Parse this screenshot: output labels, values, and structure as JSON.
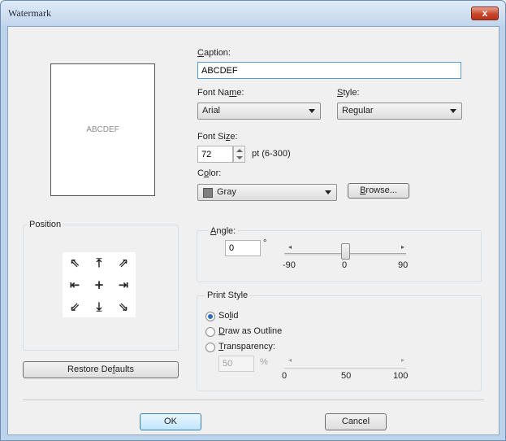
{
  "window": {
    "title": "Watermark",
    "close_glyph": "x"
  },
  "preview": {
    "text": "ABCDEF"
  },
  "caption": {
    "label": "Caption:",
    "label_mnemonic": "C",
    "label_rest": "aption:",
    "value": "ABCDEF"
  },
  "font_name": {
    "label_pre": "Font Na",
    "label_mnemonic": "m",
    "label_post": "e:",
    "value": "Arial"
  },
  "style": {
    "label_mnemonic": "S",
    "label_rest": "tyle:",
    "value": "Regular"
  },
  "font_size": {
    "label_pre": "Font Si",
    "label_mnemonic": "z",
    "label_post": "e:",
    "value": "72",
    "range_text": "pt (6-300)"
  },
  "color": {
    "label_pre": "C",
    "label_mnemonic": "o",
    "label_post": "lor:",
    "value": "Gray",
    "swatch": "#808080"
  },
  "browse": {
    "label_mnemonic": "B",
    "label_rest": "rowse..."
  },
  "position": {
    "title": "Position",
    "arrows": [
      "⇖",
      "⤒",
      "⇗",
      "⇤",
      "+",
      "⇥",
      "⇙",
      "⤓",
      "⇘"
    ],
    "arrow_icons": [
      "arrow-top-left-icon",
      "arrow-top-icon",
      "arrow-top-right-icon",
      "arrow-left-icon",
      "center-icon",
      "arrow-right-icon",
      "arrow-bottom-left-icon",
      "arrow-bottom-icon",
      "arrow-bottom-right-icon"
    ]
  },
  "restore": {
    "label_pre": "Restore De",
    "label_mnemonic": "f",
    "label_post": "aults"
  },
  "angle": {
    "label_mnemonic": "A",
    "label_rest": "ngle:",
    "value": "0",
    "unit": "°",
    "min_label": "-90",
    "mid_label": "0",
    "max_label": "90",
    "slider_value": 0
  },
  "print_style": {
    "title": "Print Style",
    "options": [
      {
        "pre": "So",
        "mnemonic": "l",
        "post": "id",
        "selected": true
      },
      {
        "pre": "",
        "mnemonic": "D",
        "post": "raw as Outline",
        "selected": false
      },
      {
        "pre": "",
        "mnemonic": "T",
        "post": "ransparency:",
        "selected": false
      }
    ],
    "transparency_value": "50",
    "transparency_unit": "%",
    "min_label": "0",
    "mid_label": "50",
    "max_label": "100"
  },
  "footer": {
    "ok": "OK",
    "cancel": "Cancel"
  }
}
